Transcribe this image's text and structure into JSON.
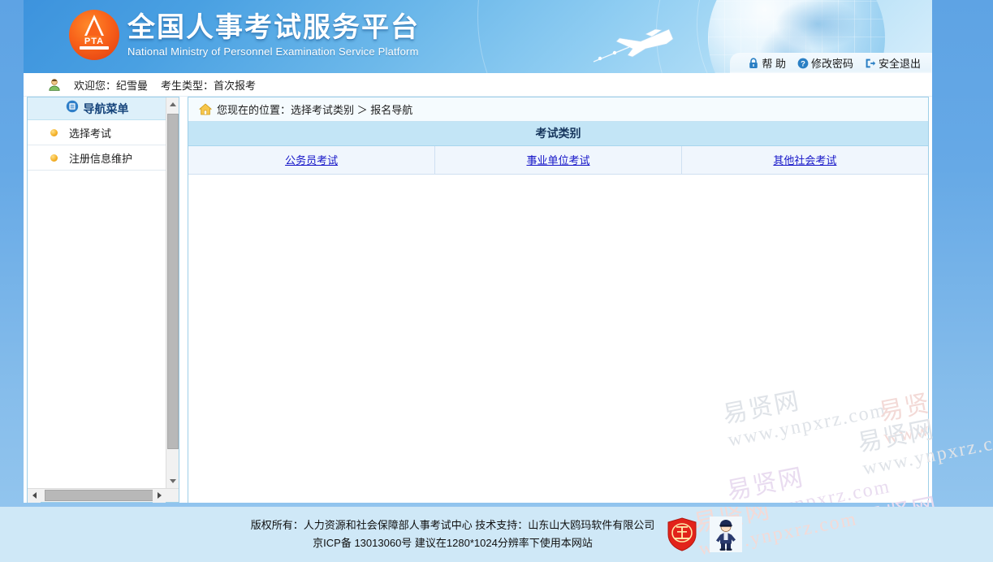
{
  "site": {
    "title_cn": "全国人事考试服务平台",
    "title_en": "National Ministry of Personnel Examination Service Platform",
    "logo_text": "PTA"
  },
  "top_links": [
    {
      "label": "帮 助",
      "icon": "lock-icon"
    },
    {
      "label": "修改密码",
      "icon": "question-icon"
    },
    {
      "label": "安全退出",
      "icon": "exit-icon"
    }
  ],
  "welcome": {
    "greeting": "欢迎您：纪雪曼",
    "candidate_type": "考生类型：首次报考",
    "icon": "user-icon"
  },
  "sidebar": {
    "header": "导航菜单",
    "header_icon": "menu-list-icon",
    "items": [
      {
        "label": "选择考试"
      },
      {
        "label": "注册信息维护"
      }
    ]
  },
  "breadcrumb": {
    "icon": "home-icon",
    "text": "您现在的位置：选择考试类别  ＞  报名导航"
  },
  "table": {
    "header": "考试类别",
    "links": [
      {
        "label": "公务员考试"
      },
      {
        "label": "事业单位考试"
      },
      {
        "label": "其他社会考试"
      }
    ]
  },
  "watermark": {
    "cn": "易贤网",
    "url": "www.ynpxrz.com"
  },
  "footer": {
    "line1": "版权所有：人力资源和社会保障部人事考试中心  技术支持：山东山大鸥玛软件有限公司",
    "line2": "京ICP备 13013060号  建议在1280*1024分辨率下使用本网站",
    "badge1": "police-shield-badge",
    "badge2": "cyber-police-officer-badge"
  },
  "colors": {
    "banner_blue": "#49a0e2",
    "page_bg": "#6ba9e5",
    "table_header": "#c3e5f6",
    "table_row": "#f0f6fd",
    "link_blue": "#1414c8",
    "sidebar_header": "#ddf0fa",
    "footer_bg": "#cfe8f7",
    "logo_orange": "#f8621a"
  }
}
